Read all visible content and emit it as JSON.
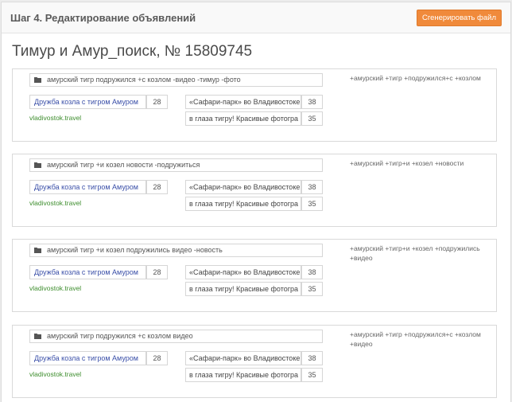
{
  "header": {
    "title": "Шаг 4. Редактирование объявлений",
    "generate_button": "Сгенерировать файл"
  },
  "campaign": {
    "title": "Тимур и Амур_поиск, № 15809745"
  },
  "ads": [
    {
      "phrase": "амурский тигр подружился +с козлом -видео -тимур -фото",
      "keywords": "+амурский +тигр +подружился+с +козлом",
      "title": "Дружба козла с тигром Амуром",
      "title_count": "28",
      "text1": "«Сафари-парк» во Владивостоке",
      "text1_count": "38",
      "text2": "в глаза тигру! Красивые фотогра",
      "text2_count": "35",
      "domain": "vladivostok.travel"
    },
    {
      "phrase": "амурский тигр +и козел новости -подружиться",
      "keywords": "+амурский +тигр+и +козел +новости",
      "title": "Дружба козла с тигром Амуром",
      "title_count": "28",
      "text1": "«Сафари-парк» во Владивостоке",
      "text1_count": "38",
      "text2": "в глаза тигру! Красивые фотогра",
      "text2_count": "35",
      "domain": "vladivostok.travel"
    },
    {
      "phrase": "амурский тигр +и козел подружились видео -новость",
      "keywords": "+амурский +тигр+и +козел +подружились +видео",
      "title": "Дружба козла с тигром Амуром",
      "title_count": "28",
      "text1": "«Сафари-парк» во Владивостоке",
      "text1_count": "38",
      "text2": "в глаза тигру! Красивые фотогра",
      "text2_count": "35",
      "domain": "vladivostok.travel"
    },
    {
      "phrase": "амурский тигр подружился +с козлом видео",
      "keywords": "+амурский +тигр +подружился+с +козлом +видео",
      "title": "Дружба козла с тигром Амуром",
      "title_count": "28",
      "text1": "«Сафари-парк» во Владивостоке",
      "text1_count": "38",
      "text2": "в глаза тигру! Красивые фотогра",
      "text2_count": "35",
      "domain": "vladivostok.travel"
    }
  ],
  "colors": {
    "accent_button": "#f08a3b",
    "title_link": "#3a4fa8",
    "domain": "#3e8e2e"
  }
}
